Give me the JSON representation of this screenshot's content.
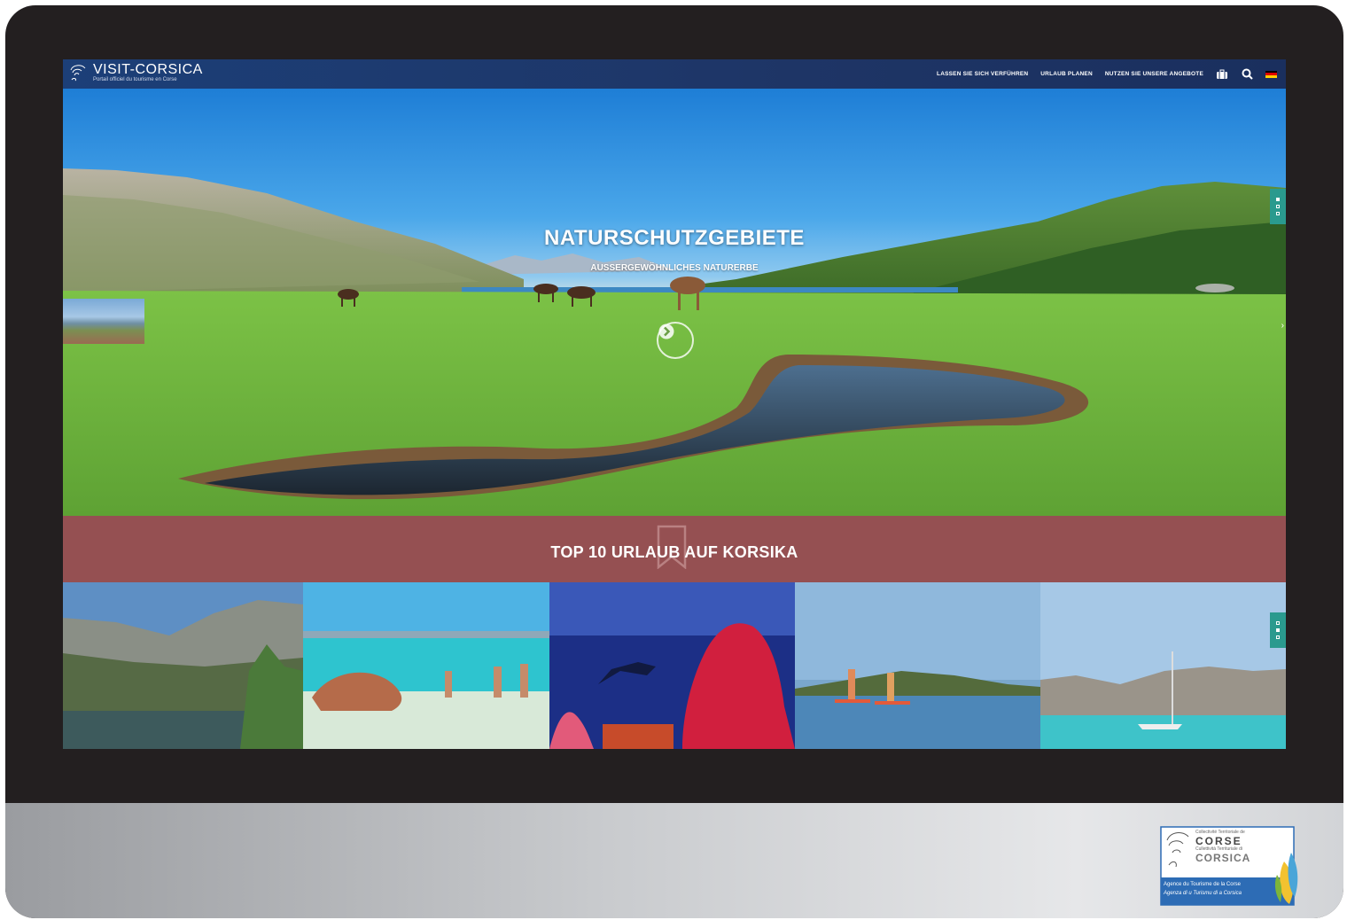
{
  "brand": {
    "name": "VISIT-CORSICA",
    "tagline": "Portail officiel du tourisme en Corse"
  },
  "nav": {
    "links": [
      "LASSEN SIE SICH VERFÜHREN",
      "URLAUB PLANEN",
      "NUTZEN SIE UNSERE ANGEBOTE"
    ],
    "icons": [
      "suitcase-icon",
      "search-icon",
      "german-flag-icon"
    ]
  },
  "hero": {
    "title": "NATURSCHUTZGEBIETE",
    "subtitle": "AUSSERGEWÖHNLICHES NATURERBE"
  },
  "banner": {
    "title": "TOP 10 URLAUB AUF KORSIKA"
  },
  "agency": {
    "line1": "Collectivité Territoriale de",
    "line2": "CORSE",
    "line3": "Cullettività Territuriale di",
    "line4": "CORSICA",
    "line5": "Agence du Tourisme de la Corse",
    "line6": "Agenza di u Turismu di a Corsica"
  },
  "colors": {
    "navbar": "#1e3566",
    "banner": "#955052",
    "pager": "#2a9a8e",
    "bezel": "#231f20"
  }
}
